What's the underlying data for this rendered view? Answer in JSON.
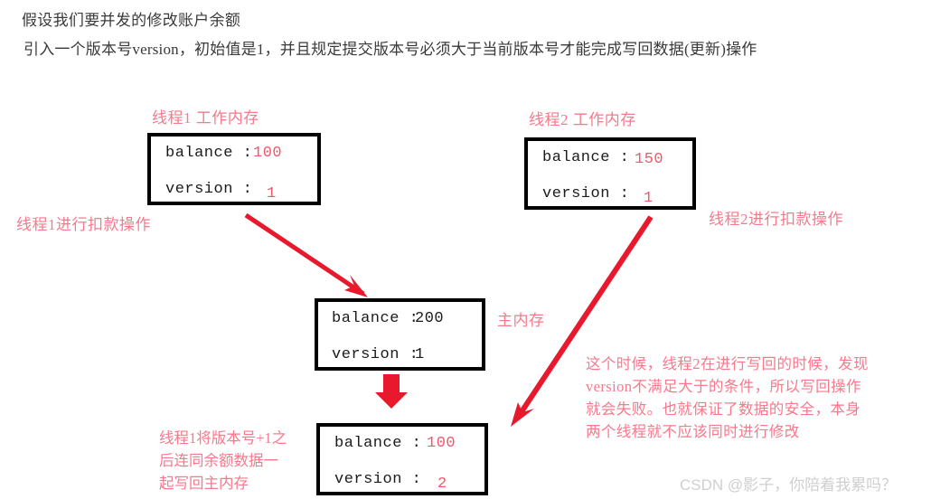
{
  "header": {
    "line1": "假设我们要并发的修改账户余额",
    "line2": "引入一个版本号version，初始值是1，并且规定提交版本号必须大于当前版本号才能完成写回数据(更新)操作"
  },
  "labels": {
    "thread1_memory": "线程1 工作内存",
    "thread2_memory": "线程2 工作内存",
    "thread1_action": "线程1进行扣款操作",
    "thread2_action": "线程2进行扣款操作",
    "main_memory": "主内存"
  },
  "boxes": {
    "thread1": {
      "balance_key": "balance :",
      "balance_value": "100",
      "version_key": "version :",
      "version_value": "1"
    },
    "thread2": {
      "balance_key": "balance :",
      "balance_value": "150",
      "version_key": "version :",
      "version_value": "1"
    },
    "main_memory": {
      "balance_key": "balance :",
      "balance_value": "200",
      "version_key": "version :",
      "version_value": "1"
    },
    "written_back": {
      "balance_key": "balance :",
      "balance_value": "100",
      "version_key": "version :",
      "version_value": "2"
    }
  },
  "annotations": {
    "writeback_note_lines": [
      "线程1将版本号+1之",
      "后连同余额数据一",
      "起写回主内存"
    ],
    "failure_note_lines": [
      "这个时候，线程2在进行写回的时候，发现",
      "version不满足大于的条件，所以写回操作",
      "就会失败。也就保证了数据的安全，本身",
      "两个线程就不应该同时进行修改"
    ]
  },
  "watermark": "CSDN @影子，你陪着我累吗？",
  "colors": {
    "box_border": "#000000",
    "arrow_red": "#e8192c",
    "label_pink": "#f8798c",
    "value_red": "#f0586b",
    "text_dark": "#3a3a3a",
    "watermark_gray": "#cfcfcf"
  }
}
